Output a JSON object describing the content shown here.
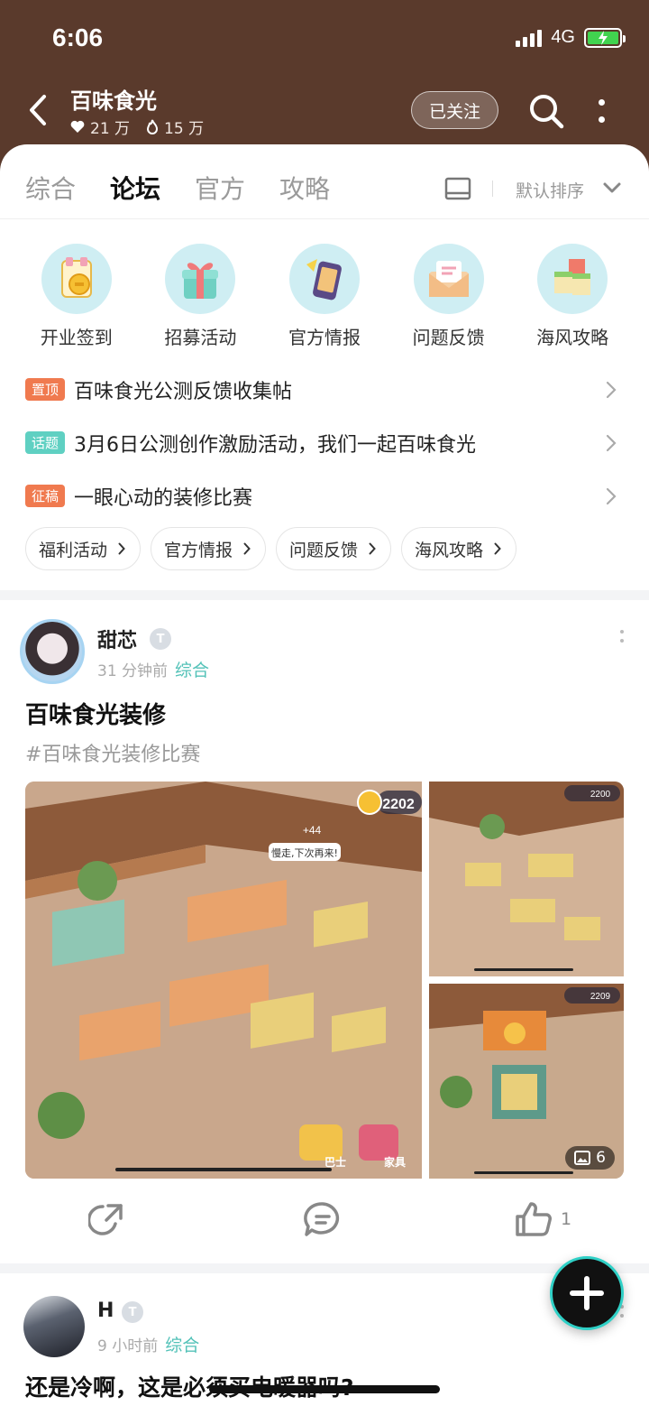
{
  "status": {
    "time": "6:06",
    "network": "4G"
  },
  "header": {
    "title": "百味食光",
    "likes": "21 万",
    "heat": "15 万",
    "follow_label": "已关注"
  },
  "tabs": [
    {
      "label": "综合",
      "active": false
    },
    {
      "label": "论坛",
      "active": true
    },
    {
      "label": "官方",
      "active": false
    },
    {
      "label": "攻略",
      "active": false
    }
  ],
  "sort_label": "默认排序",
  "categories": [
    {
      "label": "开业签到",
      "icon": "checkin-icon"
    },
    {
      "label": "招募活动",
      "icon": "gift-icon"
    },
    {
      "label": "官方情报",
      "icon": "phone-news-icon"
    },
    {
      "label": "问题反馈",
      "icon": "envelope-icon"
    },
    {
      "label": "海风攻略",
      "icon": "blocks-icon"
    }
  ],
  "pinned": [
    {
      "badge": "置顶",
      "badge_color": "#f07a4f",
      "text": "百味食光公测反馈收集帖"
    },
    {
      "badge": "话题",
      "badge_color": "#5fd0c2",
      "text": "3月6日公测创作激励活动，我们一起百味食光"
    },
    {
      "badge": "征稿",
      "badge_color": "#f07a4f",
      "text": "一眼心动的装修比赛"
    }
  ],
  "chips": [
    "福利活动",
    "官方情报",
    "问题反馈",
    "海风攻略"
  ],
  "post1": {
    "author": "甜芯",
    "level": "T",
    "time": "31 分钟前",
    "section": "综合",
    "title": "百味食光装修",
    "tag": "#百味食光装修比赛",
    "image_count": "6",
    "like_count": "1",
    "game_hud": {
      "coins": "2202",
      "bubble": "慢走,下次再来!",
      "bus": "巴士",
      "furniture": "家具",
      "side_coins1": "2200",
      "side_coins2": "2209",
      "bonus": "+44"
    }
  },
  "post2": {
    "author": "H",
    "level": "T",
    "time": "9 小时前",
    "section": "综合",
    "title": "还是冷啊，这是必须买电暖器吗?"
  },
  "colors": {
    "header_bg": "#5a3a2c",
    "accent": "#53c2b8",
    "pin_orange": "#f07a4f"
  }
}
